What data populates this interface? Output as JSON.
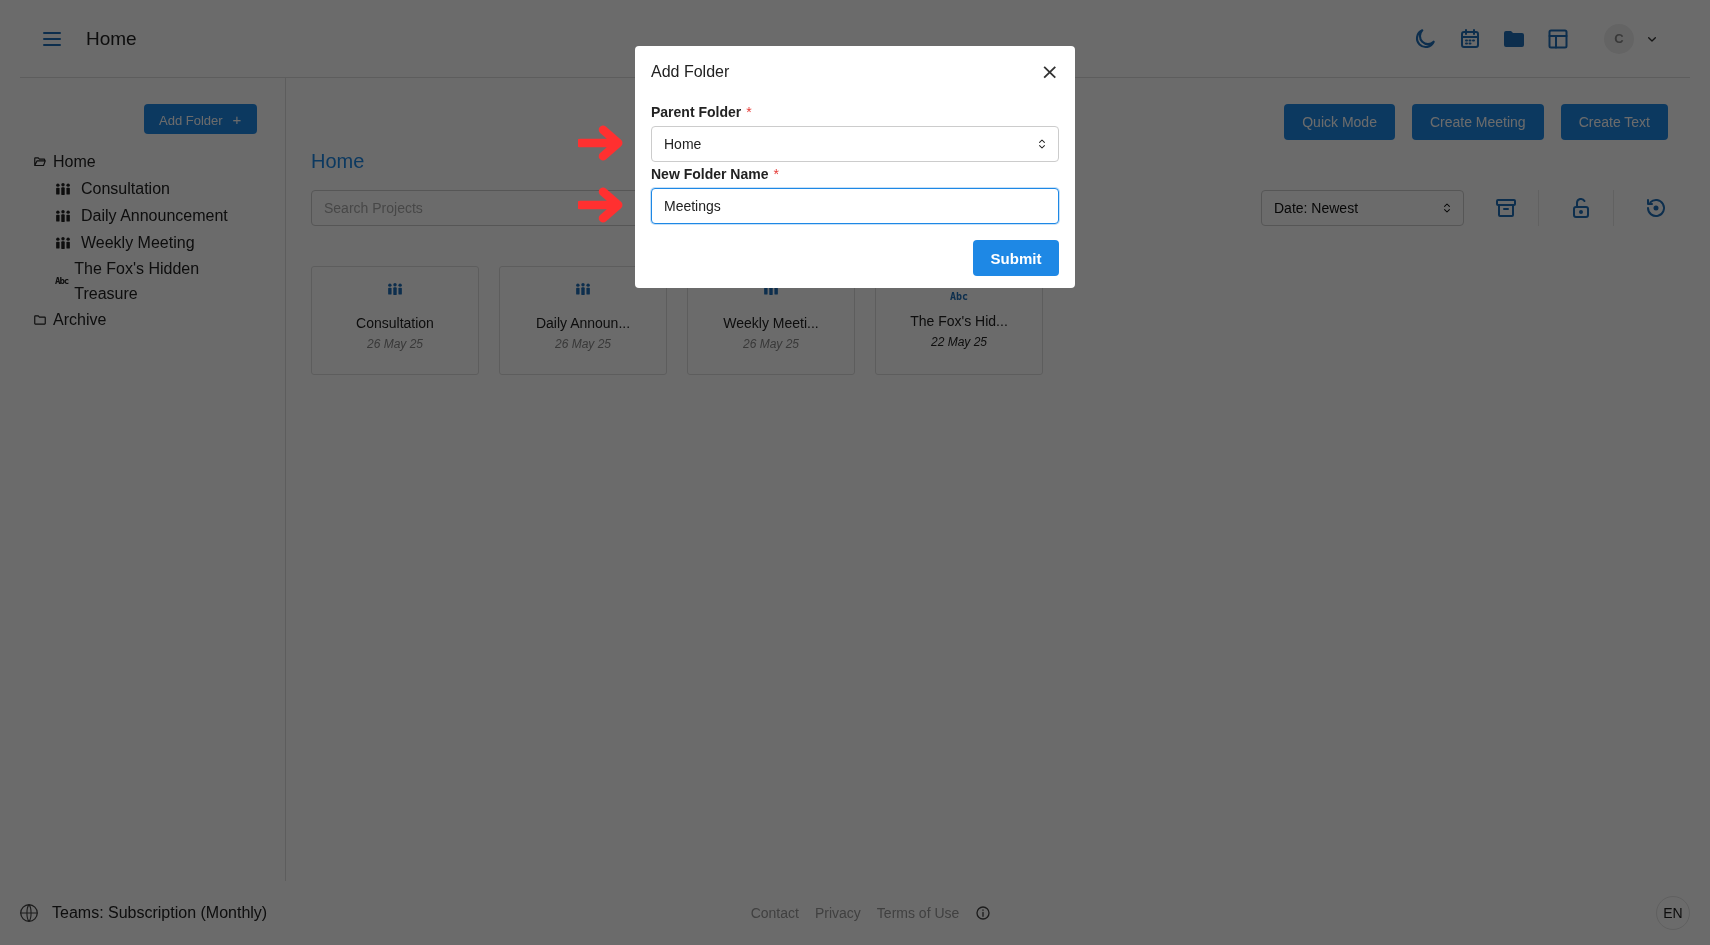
{
  "header": {
    "title": "Home",
    "avatar_letter": "C"
  },
  "sidebar": {
    "add_button": "Add Folder",
    "add_icon": "+",
    "tree": [
      {
        "label": "Home",
        "kind": "folder",
        "expanded": true,
        "children": [
          {
            "label": "Consultation",
            "kind": "meeting"
          },
          {
            "label": "Daily Announcement",
            "kind": "meeting"
          },
          {
            "label": "Weekly Meeting",
            "kind": "meeting"
          },
          {
            "label": "The Fox's Hidden Treasure",
            "kind": "text",
            "icon_text": "Abc"
          }
        ]
      },
      {
        "label": "Archive",
        "kind": "folder",
        "expanded": false
      }
    ]
  },
  "main": {
    "title": "Home",
    "actions": [
      "Quick Mode",
      "Create Meeting",
      "Create Text"
    ],
    "search": {
      "placeholder": "Search Projects"
    },
    "sort": {
      "value": "Date: Newest"
    },
    "cards": [
      {
        "kind": "meeting",
        "title": "Consultation",
        "date": "26 May 25"
      },
      {
        "kind": "meeting",
        "title": "Daily Announ...",
        "date": "26 May 25"
      },
      {
        "kind": "meeting",
        "title": "Weekly Meeti...",
        "date": "26 May 25"
      },
      {
        "kind": "text",
        "icon_text": "Abc",
        "title": "The Fox's Hid...",
        "date": "22 May 25"
      }
    ]
  },
  "dialog": {
    "title": "Add Folder",
    "close": "×",
    "fields": [
      {
        "kind": "select",
        "label": "Parent Folder",
        "required_mark": "*",
        "value": "Home",
        "focused": false,
        "annotated": true
      },
      {
        "kind": "text",
        "label": "New Folder Name",
        "required_mark": "*",
        "value": "Meetings",
        "focused": true,
        "annotated": true
      }
    ],
    "submit": "Submit"
  },
  "footer": {
    "plan": "Teams: Subscription (Monthly)",
    "links": [
      "Contact",
      "Privacy",
      "Terms of Use"
    ],
    "language": "EN"
  }
}
